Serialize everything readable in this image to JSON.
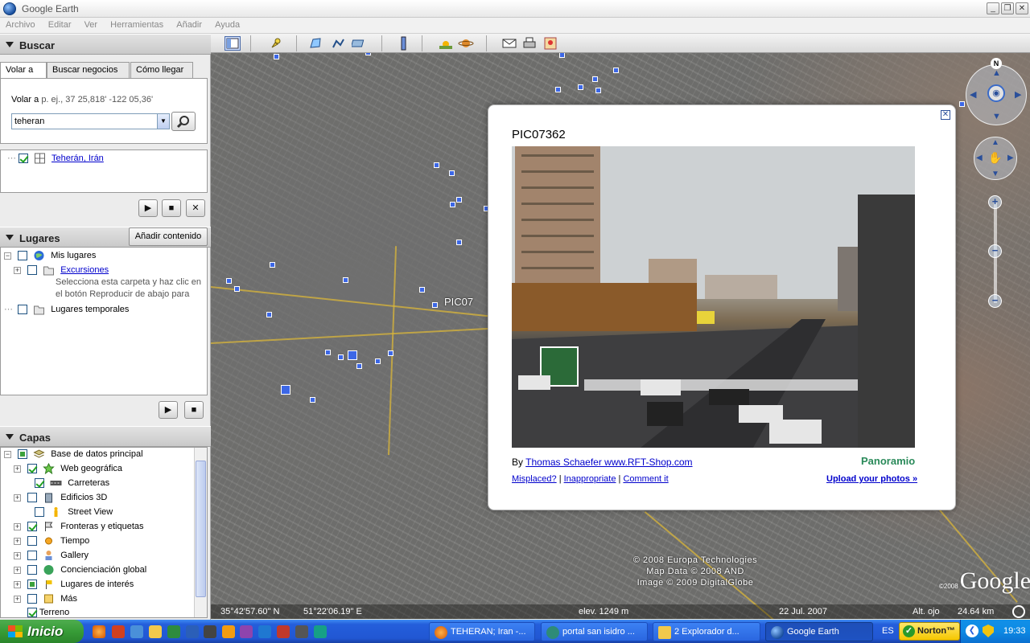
{
  "window": {
    "title": "Google Earth"
  },
  "menu": [
    "Archivo",
    "Editar",
    "Ver",
    "Herramientas",
    "Añadir",
    "Ayuda"
  ],
  "search": {
    "header": "Buscar",
    "tabs": [
      "Volar a",
      "Buscar negocios",
      "Cómo llegar"
    ],
    "fly_label": "Volar a",
    "fly_hint": "p. ej., 37 25,818' -122 05,36'",
    "query": "teheran",
    "result": "Teherán, Irán"
  },
  "places": {
    "header": "Lugares",
    "add_button": "Añadir contenido",
    "items": {
      "my_places": "Mis lugares",
      "tours": "Excursiones",
      "tours_desc_1": "Selecciona esta carpeta y haz clic en",
      "tours_desc_2": "el botón Reproducir de abajo para",
      "temp": "Lugares temporales"
    }
  },
  "layers": {
    "header": "Capas",
    "items": [
      "Base de datos principal",
      "Web geográfica",
      "Carreteras",
      "Edificios 3D",
      "Street View",
      "Fronteras y etiquetas",
      "Tiempo",
      "Gallery",
      "Conciencia­ción global",
      "Lugares de interés",
      "Más",
      "Terreno"
    ]
  },
  "balloon": {
    "title": "PIC07362",
    "by_prefix": "By",
    "author": "Thomas Schaefer www.RFT-Shop.com",
    "brand": "Panoramio",
    "link_misplaced": "Misplaced?",
    "link_inappropriate": "Inappropriate",
    "link_comment": "Comment it",
    "upload": "Upload your photos »"
  },
  "map": {
    "label": "PIC07",
    "caption_1": "© 2008 Europa Technologies",
    "caption_2": "Map Data © 2008 AND",
    "caption_3": "Image © 2009 DigitalGlobe",
    "logo": "Google",
    "logo_year": "©2008",
    "compass_n": "N",
    "lat": "35°42'57.60\" N",
    "lon": "51°22'06.19\" E",
    "elev": "elev.  1249 m",
    "date": "22 Jul. 2007",
    "eye_label": "Alt. ojo",
    "eye_value": "24.64 km"
  },
  "taskbar": {
    "start": "Inicio",
    "tasks": [
      "TEHERAN; Iran -...",
      "portal san isidro ...",
      "2 Explorador d...",
      "Google Earth"
    ],
    "lang": "ES",
    "norton": "Norton™",
    "clock": "19:33"
  },
  "colors": {
    "accent": "#3c67e6",
    "link": "#0000cc",
    "taskbar": "#245edb",
    "start": "#379c37"
  }
}
